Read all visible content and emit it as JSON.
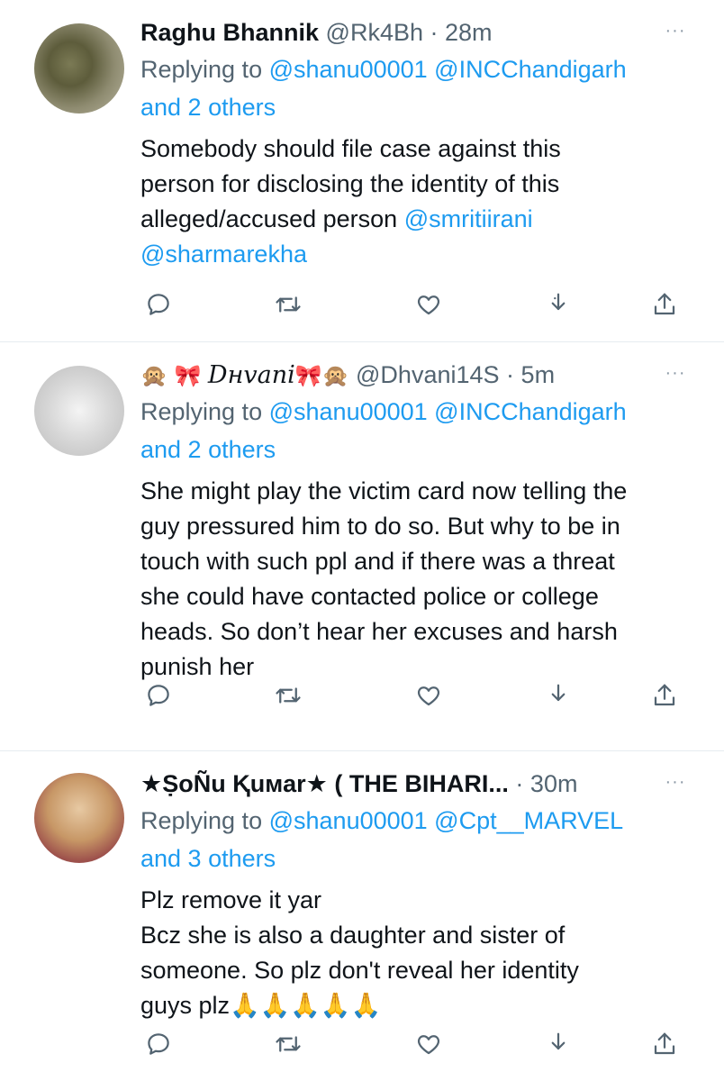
{
  "tweets": [
    {
      "display_name": "Raghu Bhannik",
      "handle": "@Rk4Bh",
      "time": "28m",
      "replying_prefix": "Replying to",
      "reply_mentions": "@shanu00001 @INCChandigarh",
      "reply_others": "and 2 others",
      "lines": [
        "Somebody should file case against this",
        "person for disclosing the identity of this",
        "alleged/accused person"
      ],
      "inline_mention": "@smritiirani",
      "last_mention": "@sharmarekha"
    },
    {
      "emoji_left": "🙊 🎀",
      "display_name": "Dнvani",
      "emoji_right": "🎀🙊",
      "handle": "@Dhvani14S",
      "time": "5m",
      "replying_prefix": "Replying to",
      "reply_mentions": "@shanu00001 @INCChandigarh",
      "reply_others": "and 2 others",
      "lines": [
        "She might play the victim card now telling the",
        "guy pressured him to do so. But why to be in",
        "touch with such ppl and if there was a threat",
        "she could have contacted police or college",
        "heads. So don’t hear her excuses and harsh",
        "punish her"
      ]
    },
    {
      "display_name": "★ṢoÑu Ⱪuмar★ ( THE BIHARI...",
      "time": "30m",
      "replying_prefix": "Replying to",
      "reply_mentions": "@shanu00001 @Cpt__MARVEL",
      "reply_others": "and 3 others",
      "lines": [
        "Plz remove it yar",
        "Bcz she is also a daughter and sister of",
        "someone. So plz don't reveal her identity",
        "guys plz🙏🙏🙏🙏🙏"
      ]
    }
  ],
  "separator": "·",
  "more": "···",
  "icons": [
    "reply-icon",
    "retweet-icon",
    "like-icon",
    "save-icon",
    "share-icon"
  ],
  "colors": {
    "link": "#1d9bf0",
    "muted": "#536471",
    "text": "#0f1419",
    "icon": "#536471"
  }
}
